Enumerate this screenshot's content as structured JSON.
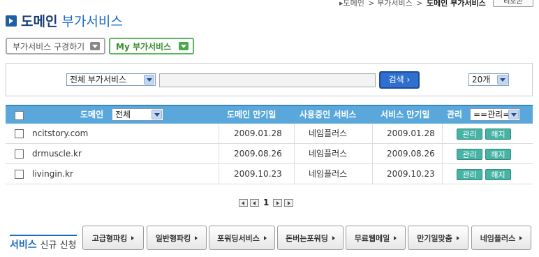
{
  "breadcrumb": {
    "items": [
      "▸도메인",
      "> 부가서비스",
      ">"
    ],
    "current": "도메인 부가서비스",
    "zoom_label": "리모콘"
  },
  "header": {
    "title_main": "도메인",
    "title_sub": "부가서비스"
  },
  "tabs": [
    {
      "label": "부가서비스 구경하기"
    },
    {
      "label": "My 부가서비스"
    }
  ],
  "search": {
    "type_selected": "전체 부가서비스",
    "keyword_value": "",
    "button_label": "검색",
    "count_selected": "20개"
  },
  "grid": {
    "headers": {
      "domain": "도메인",
      "domain_filter": "전체",
      "domain_expiry": "도메인 만기일",
      "service_in_use": "사용중인 서비스",
      "service_expiry": "서비스 만기일",
      "manage": "관리",
      "manage_select": "==관리=="
    },
    "rows": [
      {
        "domain": "ncitstory.com",
        "domain_expiry": "2009.01.28",
        "service": "네임플러스",
        "service_expiry": "2009.01.28",
        "btn_manage": "관리",
        "btn_cancel": "해지"
      },
      {
        "domain": "drmuscle.kr",
        "domain_expiry": "2009.08.26",
        "service": "네임플러스",
        "service_expiry": "2009.08.26",
        "btn_manage": "관리",
        "btn_cancel": "해지"
      },
      {
        "domain": "livingin.kr",
        "domain_expiry": "2009.10.23",
        "service": "네임플러스",
        "service_expiry": "2009.10.23",
        "btn_manage": "관리",
        "btn_cancel": "해지"
      }
    ]
  },
  "pager": {
    "current_page": "1"
  },
  "new_service": {
    "title_bold": "서비스",
    "title_thin": "신규 신청",
    "buttons": [
      "고급형파킹",
      "일반형파킹",
      "포워딩서비스",
      "돈버는포워딩",
      "무료웹메일",
      "만기일맞춤",
      "네임플러스"
    ]
  }
}
